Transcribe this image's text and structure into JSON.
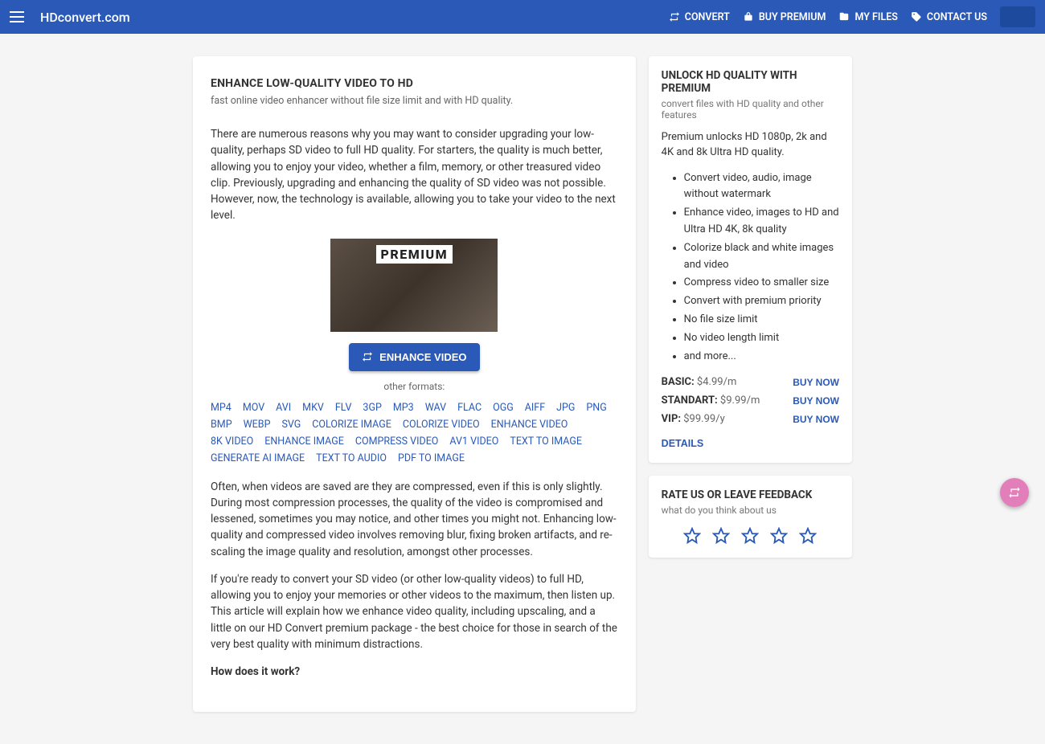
{
  "header": {
    "brand": "HDconvert.com",
    "nav": {
      "convert": "CONVERT",
      "buy_premium": "BUY PREMIUM",
      "my_files": "MY FILES",
      "contact_us": "CONTACT US"
    }
  },
  "main": {
    "title": "ENHANCE LOW-QUALITY VIDEO TO HD",
    "subtitle": "fast online video enhancer without file size limit and with HD quality.",
    "para1": "There are numerous reasons why you may want to consider upgrading your low-quality, perhaps SD video to full HD quality. For starters, the quality is much better, allowing you to enjoy your video, whether a film, memory, or other treasured video clip. Previously, upgrading and enhancing the quality of SD video was not possible. However, now, the technology is available, allowing you to take your video to the next level.",
    "thumb_badge": "PREMIUM",
    "cta": "ENHANCE VIDEO",
    "other_formats_label": "other formats:",
    "formats": [
      "MP4",
      "MOV",
      "AVI",
      "MKV",
      "FLV",
      "3GP",
      "MP3",
      "WAV",
      "FLAC",
      "OGG",
      "AIFF",
      "JPG",
      "PNG",
      "BMP",
      "WEBP",
      "SVG",
      "COLORIZE IMAGE",
      "COLORIZE VIDEO",
      "ENHANCE VIDEO",
      "8K VIDEO",
      "ENHANCE IMAGE",
      "COMPRESS VIDEO",
      "AV1 VIDEO",
      "TEXT TO IMAGE",
      "GENERATE AI IMAGE",
      "TEXT TO AUDIO",
      "PDF TO IMAGE"
    ],
    "para2": "Often, when videos are saved are they are compressed, even if this is only slightly. During most compression processes, the quality of the video is compromised and lessened, sometimes you may notice, and other times you might not. Enhancing low-quality and compressed video involves removing blur, fixing broken artifacts, and re-scaling the image quality and resolution, amongst other processes.",
    "para3": "If you're ready to convert your SD video (or other low-quality videos) to full HD, allowing you to enjoy your memories or other videos to the maximum, then listen up. This article will explain how we enhance video quality, including upscaling, and a little on our HD Convert premium package - the best choice for those in search of the very best quality with minimum distractions.",
    "how_heading": "How does it work?"
  },
  "premium": {
    "title": "UNLOCK HD QUALITY WITH PREMIUM",
    "subtitle": "convert files with HD quality and other features",
    "intro": "Premium unlocks HD 1080p, 2k and 4K and 8k Ultra HD quality.",
    "features": [
      "Convert video, audio, image without watermark",
      "Enhance video, images to HD and Ultra HD 4K, 8k quality",
      "Colorize black and white images and video",
      "Compress video to smaller size",
      "Convert with premium priority",
      "No file size limit",
      "No video length limit",
      "and more..."
    ],
    "plans": [
      {
        "label": "BASIC:",
        "price": "$4.99/m",
        "buy": "BUY NOW"
      },
      {
        "label": "STANDART:",
        "price": "$9.99/m",
        "buy": "BUY NOW"
      },
      {
        "label": "VIP:",
        "price": "$99.99/y",
        "buy": "BUY NOW"
      }
    ],
    "details": "DETAILS"
  },
  "feedback": {
    "title": "RATE US OR LEAVE FEEDBACK",
    "subtitle": "what do you think about us"
  }
}
